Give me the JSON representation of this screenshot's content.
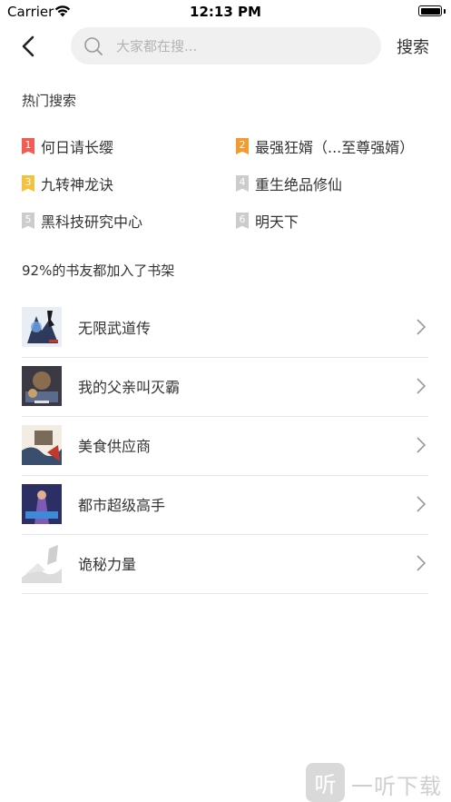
{
  "status_bar": {
    "carrier": "Carrier",
    "time": "12:13 PM"
  },
  "header": {
    "search_placeholder": "大家都在搜...",
    "search_button": "搜索"
  },
  "hot_search": {
    "title": "热门搜索",
    "items": [
      {
        "rank": "1",
        "label": "何日请长缨",
        "color": "#f25c54"
      },
      {
        "rank": "2",
        "label": "最强狂婿（...至尊强婿）",
        "color": "#f59a2f"
      },
      {
        "rank": "3",
        "label": "九转神龙诀",
        "color": "#f5c23f"
      },
      {
        "rank": "4",
        "label": "重生绝品修仙",
        "color": "#cccccc"
      },
      {
        "rank": "5",
        "label": "黑科技研究中心",
        "color": "#cccccc"
      },
      {
        "rank": "6",
        "label": "明天下",
        "color": "#cccccc"
      }
    ]
  },
  "bookshelf": {
    "title": "92%的书友都加入了书架",
    "books": [
      {
        "title": "无限武道传"
      },
      {
        "title": "我的父亲叫灭霸"
      },
      {
        "title": "美食供应商"
      },
      {
        "title": "都市超级高手"
      },
      {
        "title": "诡秘力量"
      }
    ]
  },
  "watermark": {
    "badge": "听",
    "text": "一听下载"
  }
}
